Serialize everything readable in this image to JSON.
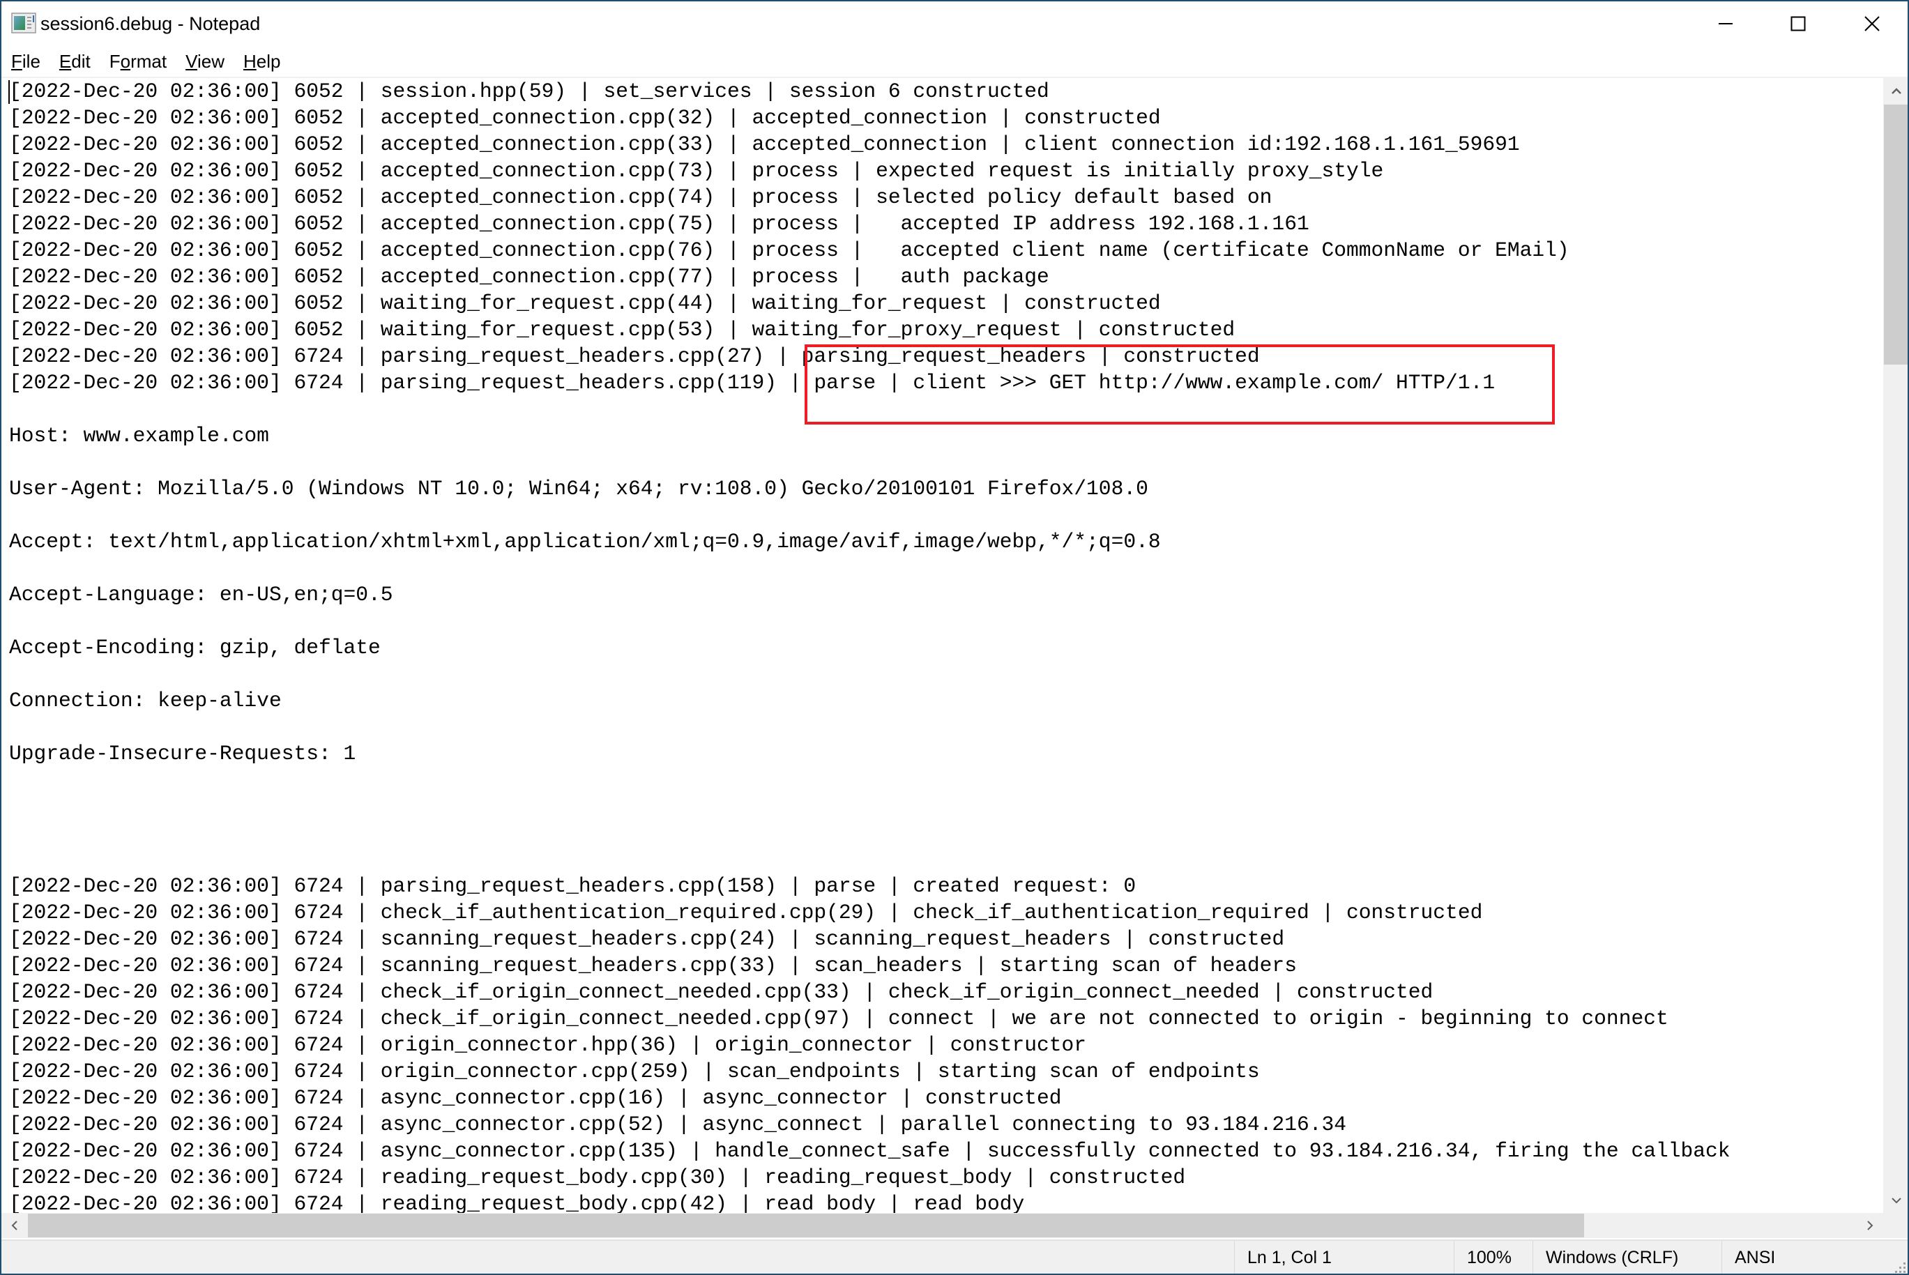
{
  "window": {
    "title": "session6.debug - Notepad",
    "app_icon": "notepad-icon",
    "controls": {
      "minimize": "minimize-icon",
      "maximize": "maximize-icon",
      "close": "close-icon"
    }
  },
  "menu": {
    "items": [
      {
        "label_accel": "F",
        "label_rest": "ile"
      },
      {
        "label_accel": "E",
        "label_rest": "dit"
      },
      {
        "label_pre": "F",
        "label_accel": "o",
        "label_rest": "rmat"
      },
      {
        "label_accel": "V",
        "label_rest": "iew"
      },
      {
        "label_accel": "H",
        "label_rest": "elp"
      }
    ]
  },
  "editor": {
    "lines": [
      "[2022-Dec-20 02:36:00] 6052 | session.hpp(59) | set_services | session 6 constructed",
      "[2022-Dec-20 02:36:00] 6052 | accepted_connection.cpp(32) | accepted_connection | constructed",
      "[2022-Dec-20 02:36:00] 6052 | accepted_connection.cpp(33) | accepted_connection | client connection id:192.168.1.161_59691",
      "[2022-Dec-20 02:36:00] 6052 | accepted_connection.cpp(73) | process | expected request is initially proxy_style",
      "[2022-Dec-20 02:36:00] 6052 | accepted_connection.cpp(74) | process | selected policy default based on",
      "[2022-Dec-20 02:36:00] 6052 | accepted_connection.cpp(75) | process |   accepted IP address 192.168.1.161",
      "[2022-Dec-20 02:36:00] 6052 | accepted_connection.cpp(76) | process |   accepted client name (certificate CommonName or EMail)",
      "[2022-Dec-20 02:36:00] 6052 | accepted_connection.cpp(77) | process |   auth package",
      "[2022-Dec-20 02:36:00] 6052 | waiting_for_request.cpp(44) | waiting_for_request | constructed",
      "[2022-Dec-20 02:36:00] 6052 | waiting_for_request.cpp(53) | waiting_for_proxy_request | constructed",
      "[2022-Dec-20 02:36:00] 6724 | parsing_request_headers.cpp(27) | parsing_request_headers | constructed",
      "[2022-Dec-20 02:36:00] 6724 | parsing_request_headers.cpp(119) | parse | client >>> GET http://www.example.com/ HTTP/1.1",
      "",
      "Host: www.example.com",
      "",
      "User-Agent: Mozilla/5.0 (Windows NT 10.0; Win64; x64; rv:108.0) Gecko/20100101 Firefox/108.0",
      "",
      "Accept: text/html,application/xhtml+xml,application/xml;q=0.9,image/avif,image/webp,*/*;q=0.8",
      "",
      "Accept-Language: en-US,en;q=0.5",
      "",
      "Accept-Encoding: gzip, deflate",
      "",
      "Connection: keep-alive",
      "",
      "Upgrade-Insecure-Requests: 1",
      "",
      "",
      "",
      "",
      "[2022-Dec-20 02:36:00] 6724 | parsing_request_headers.cpp(158) | parse | created request: 0",
      "[2022-Dec-20 02:36:00] 6724 | check_if_authentication_required.cpp(29) | check_if_authentication_required | constructed",
      "[2022-Dec-20 02:36:00] 6724 | scanning_request_headers.cpp(24) | scanning_request_headers | constructed",
      "[2022-Dec-20 02:36:00] 6724 | scanning_request_headers.cpp(33) | scan_headers | starting scan of headers",
      "[2022-Dec-20 02:36:00] 6724 | check_if_origin_connect_needed.cpp(33) | check_if_origin_connect_needed | constructed",
      "[2022-Dec-20 02:36:00] 6724 | check_if_origin_connect_needed.cpp(97) | connect | we are not connected to origin - beginning to connect",
      "[2022-Dec-20 02:36:00] 6724 | origin_connector.hpp(36) | origin_connector | constructor",
      "[2022-Dec-20 02:36:00] 6724 | origin_connector.cpp(259) | scan_endpoints | starting scan of endpoints",
      "[2022-Dec-20 02:36:00] 6724 | async_connector.cpp(16) | async_connector | constructed",
      "[2022-Dec-20 02:36:00] 6724 | async_connector.cpp(52) | async_connect | parallel connecting to 93.184.216.34",
      "[2022-Dec-20 02:36:00] 6724 | async_connector.cpp(135) | handle_connect_safe | successfully connected to 93.184.216.34, firing the callback",
      "[2022-Dec-20 02:36:00] 6724 | reading_request_body.cpp(30) | reading_request_body | constructed",
      "[2022-Dec-20 02:36:00] 6724 | reading_request_body.cpp(42) | read body | read body"
    ],
    "annotation": {
      "color": "#ee1c25",
      "note": "highlighted parse lines"
    }
  },
  "scrollbars": {
    "vertical": {
      "up": "chevron-up-icon",
      "down": "chevron-down-icon",
      "position_fraction": 0.0
    },
    "horizontal": {
      "left": "chevron-left-icon",
      "right": "chevron-right-icon",
      "position_fraction": 0.0
    }
  },
  "statusbar": {
    "position": "Ln 1, Col 1",
    "zoom": "100%",
    "line_ending": "Windows (CRLF)",
    "encoding": "ANSI"
  }
}
